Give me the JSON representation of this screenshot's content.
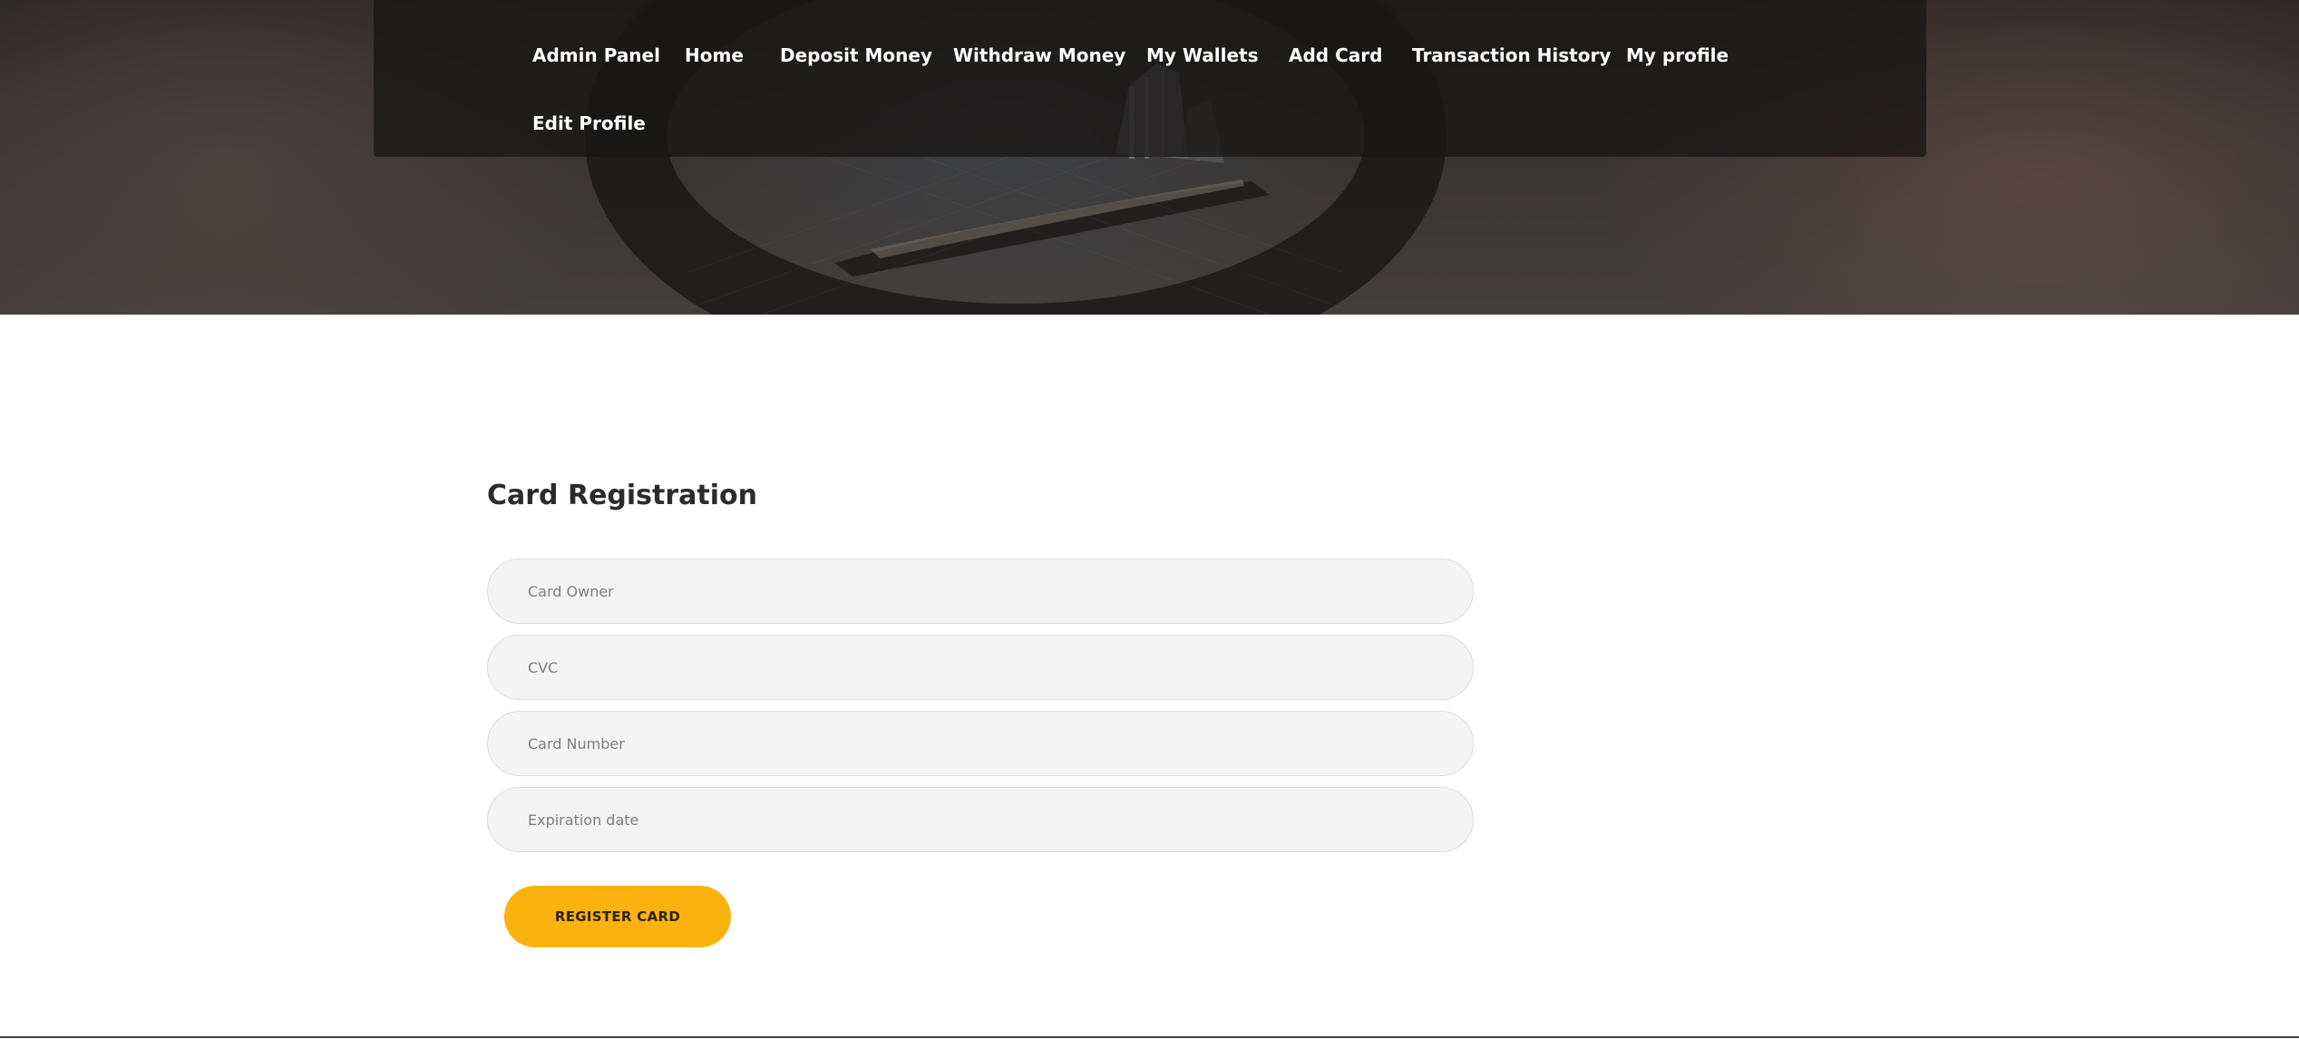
{
  "nav": {
    "items": [
      {
        "label": "Admin Panel"
      },
      {
        "label": "Home"
      },
      {
        "label": "Deposit Money"
      },
      {
        "label": "Withdraw Money"
      },
      {
        "label": "My Wallets"
      },
      {
        "label": "Add Card"
      },
      {
        "label": "Transaction History"
      },
      {
        "label": "My profile"
      },
      {
        "label": "Edit Profile"
      }
    ]
  },
  "form": {
    "title": "Card Registration",
    "fields": [
      {
        "placeholder": "Card Owner",
        "value": ""
      },
      {
        "placeholder": "CVC",
        "value": ""
      },
      {
        "placeholder": "Card Number",
        "value": ""
      },
      {
        "placeholder": "Expiration date",
        "value": ""
      }
    ],
    "submit_label": "REGISTER CARD"
  },
  "colors": {
    "accent": "#fbb20f",
    "nav_background": "#181615",
    "nav_text": "#ffffff",
    "title_text": "#2b2b2b",
    "field_background": "#f4f4f4"
  },
  "icons": {
    "hero_background": "city-reflection-in-lens-image"
  }
}
